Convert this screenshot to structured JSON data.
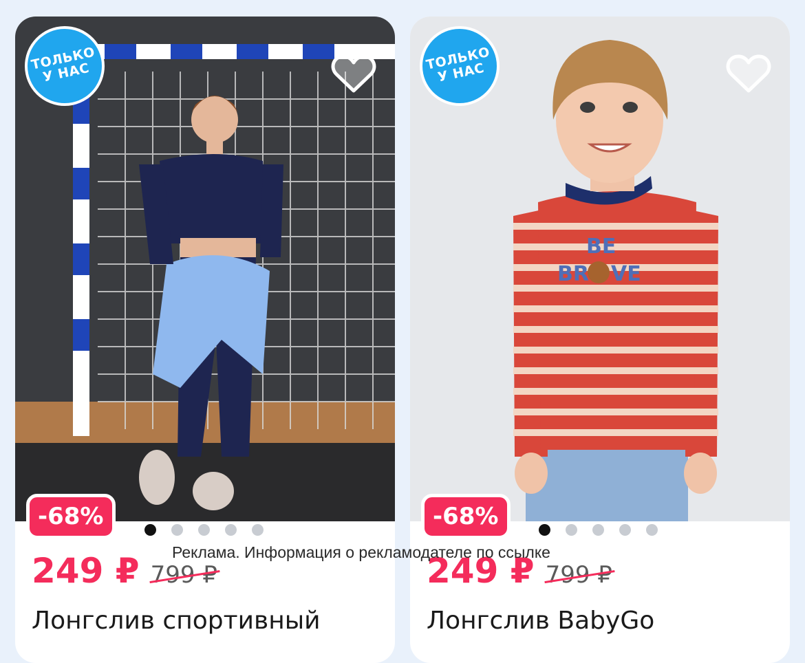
{
  "ad_note": "Реклама. Информация о рекламодателе по ссылке",
  "colors": {
    "background": "#e9f1fb",
    "exclusive_badge": "#20a6ee",
    "discount_badge": "#f42c5b",
    "price": "#f42c5b"
  },
  "products": [
    {
      "badge": "ТОЛЬКО\nУ НАС",
      "favorite_icon": "heart-outline-icon",
      "discount": "-68%",
      "price": "249 ₽",
      "old_price": "799 ₽",
      "title": "Лонгслив спортивный",
      "gallery_dots": 5,
      "active_dot": 0
    },
    {
      "badge": "ТОЛЬКО\nУ НАС",
      "favorite_icon": "heart-outline-icon",
      "discount": "-68%",
      "price": "249 ₽",
      "old_price": "799 ₽",
      "title": "Лонгслив BabyGo",
      "print_text": "BE BRAVE",
      "gallery_dots": 5,
      "active_dot": 0
    }
  ]
}
